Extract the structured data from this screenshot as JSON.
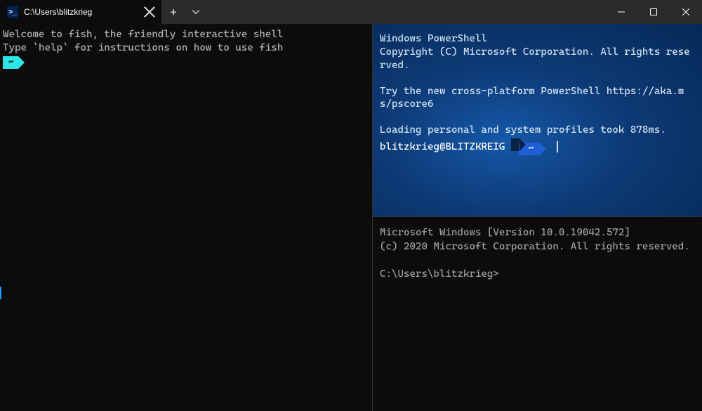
{
  "titlebar": {
    "tab": {
      "title": "C:\\Users\\blitzkrieg",
      "icon_glyph": ">_"
    },
    "new_tab_label": "+",
    "dropdown_glyph": "⌄"
  },
  "panes": {
    "fish": {
      "lines": [
        "Welcome to fish, the friendly interactive shell",
        "Type `help` for instructions on how to use fish"
      ],
      "prompt_text": "~"
    },
    "powershell": {
      "lines": [
        "Windows PowerShell",
        "Copyright (C) Microsoft Corporation. All rights reserved.",
        "",
        "Try the new cross-platform PowerShell https://aka.ms/pscore6",
        "",
        "Loading personal and system profiles took 878ms."
      ],
      "prompt_user": "blitzkrieg@BLITZKREIG",
      "prompt_path": "~"
    },
    "cmd": {
      "lines": [
        "Microsoft Windows [Version 10.0.19042.572]",
        "(c) 2020 Microsoft Corporation. All rights reserved.",
        "",
        "C:\\Users\\blitzkrieg>"
      ]
    }
  }
}
